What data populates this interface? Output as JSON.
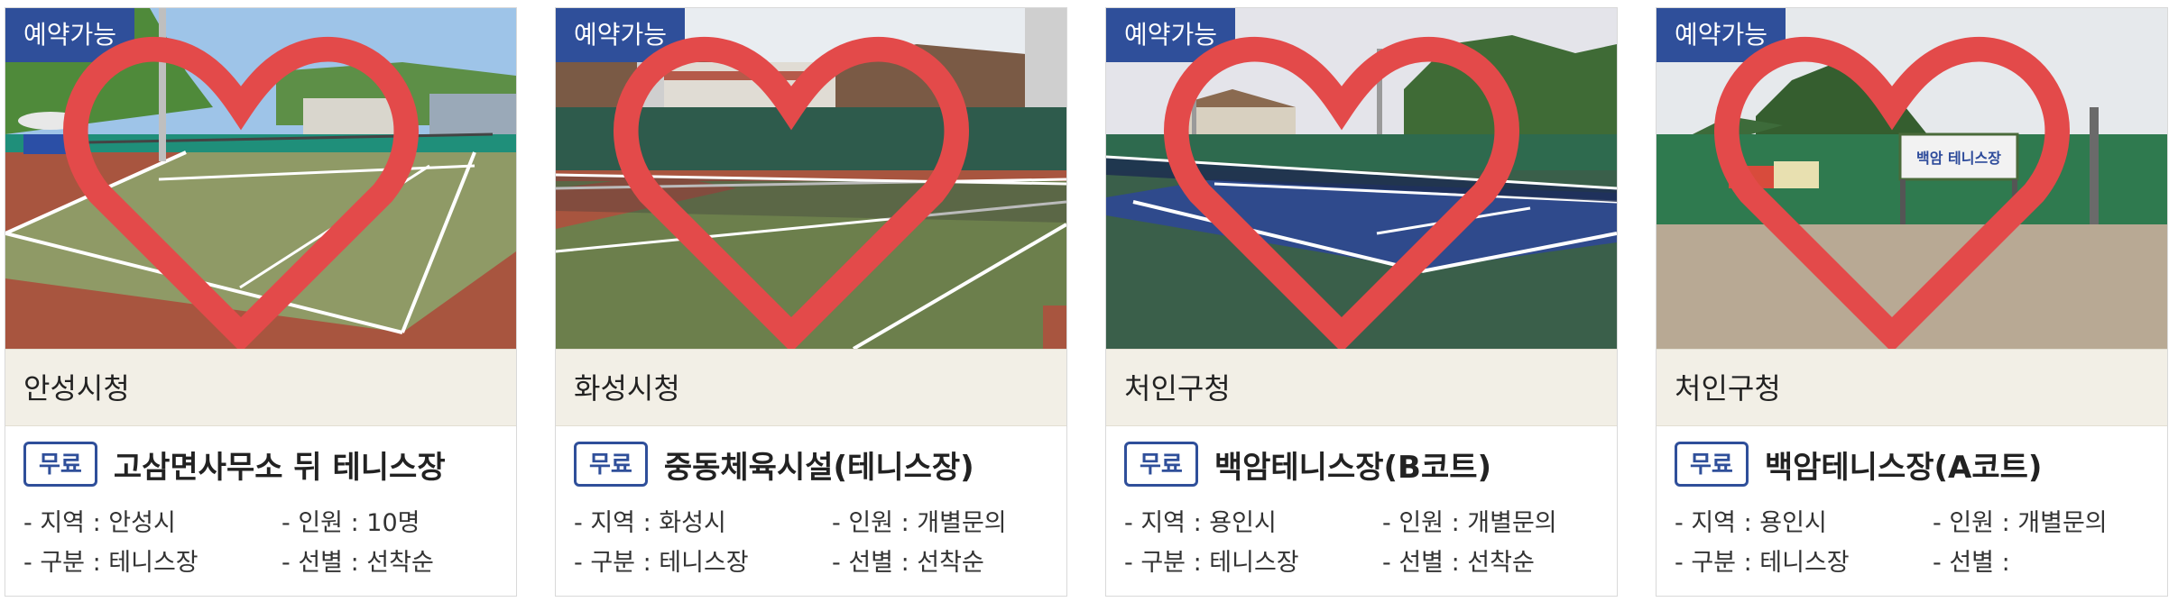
{
  "cards": [
    {
      "status": "예약가능",
      "agency": "안성시청",
      "fee": "무료",
      "title": "고삼면사무소 뒤 테니스장",
      "region": "- 지역 : 안성시",
      "capacity": "- 인원 : 10명",
      "category": "- 구분 : 테니스장",
      "selection": "- 선별 : 선착순"
    },
    {
      "status": "예약가능",
      "agency": "화성시청",
      "fee": "무료",
      "title": "중동체육시설(테니스장)",
      "region": "- 지역 : 화성시",
      "capacity": "- 인원 : 개별문의",
      "category": "- 구분 : 테니스장",
      "selection": "- 선별 : 선착순"
    },
    {
      "status": "예약가능",
      "agency": "처인구청",
      "fee": "무료",
      "title": "백암테니스장(B코트)",
      "region": "- 지역 : 용인시",
      "capacity": "- 인원 : 개별문의",
      "category": "- 구분 : 테니스장",
      "selection": "- 선별 : 선착순"
    },
    {
      "status": "예약가능",
      "agency": "처인구청",
      "fee": "무료",
      "title": "백암테니스장(A코트)",
      "region": "- 지역 : 용인시",
      "capacity": "- 인원 : 개별문의",
      "category": "- 구분 : 테니스장",
      "selection": "- 선별 :",
      "sign_text": "백암 테니스장"
    }
  ],
  "colors": {
    "badge_bg": "#2f4f9a",
    "heart": "#e34a4a",
    "agency_bg": "#f2efe6"
  },
  "icons": {
    "favorite": "heart-outline-icon"
  }
}
